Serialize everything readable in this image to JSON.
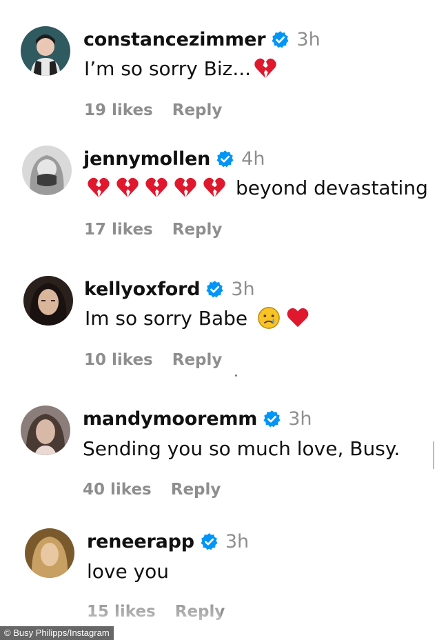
{
  "comments": [
    {
      "username": "constancezimmer",
      "time": "3h",
      "text": "I’m so sorry Biz...",
      "likes": "19 likes",
      "reply": "Reply",
      "emojis": [
        "broken-heart"
      ],
      "avatar_color": "#2f4f55"
    },
    {
      "username": "jennymollen",
      "time": "4h",
      "text": "beyond devastating",
      "likes": "17 likes",
      "reply": "Reply",
      "emojis": [
        "broken-heart",
        "broken-heart",
        "broken-heart",
        "broken-heart",
        "broken-heart"
      ],
      "avatar_color": "#9a9a9a"
    },
    {
      "username": "kellyoxford",
      "time": "3h",
      "text": "Im so sorry Babe",
      "likes": "10 likes",
      "reply": "Reply",
      "emojis": [
        "crying-face",
        "red-heart"
      ],
      "avatar_color": "#3a2a24"
    },
    {
      "username": "mandymooremm",
      "time": "3h",
      "text": "Sending you so much love, Busy.",
      "likes": "40 likes",
      "reply": "Reply",
      "emojis": [],
      "avatar_color": "#7f6a63"
    },
    {
      "username": "reneerapp",
      "time": "3h",
      "text": "love you",
      "likes": "15 likes",
      "reply": "Reply",
      "emojis": [],
      "avatar_color": "#a3733e"
    }
  ],
  "credit": "© Busy Philipps/Instagram",
  "colors": {
    "verified_blue": "#0095f6",
    "meta_gray": "#8e8e8e",
    "heart_red": "#e0182d"
  }
}
